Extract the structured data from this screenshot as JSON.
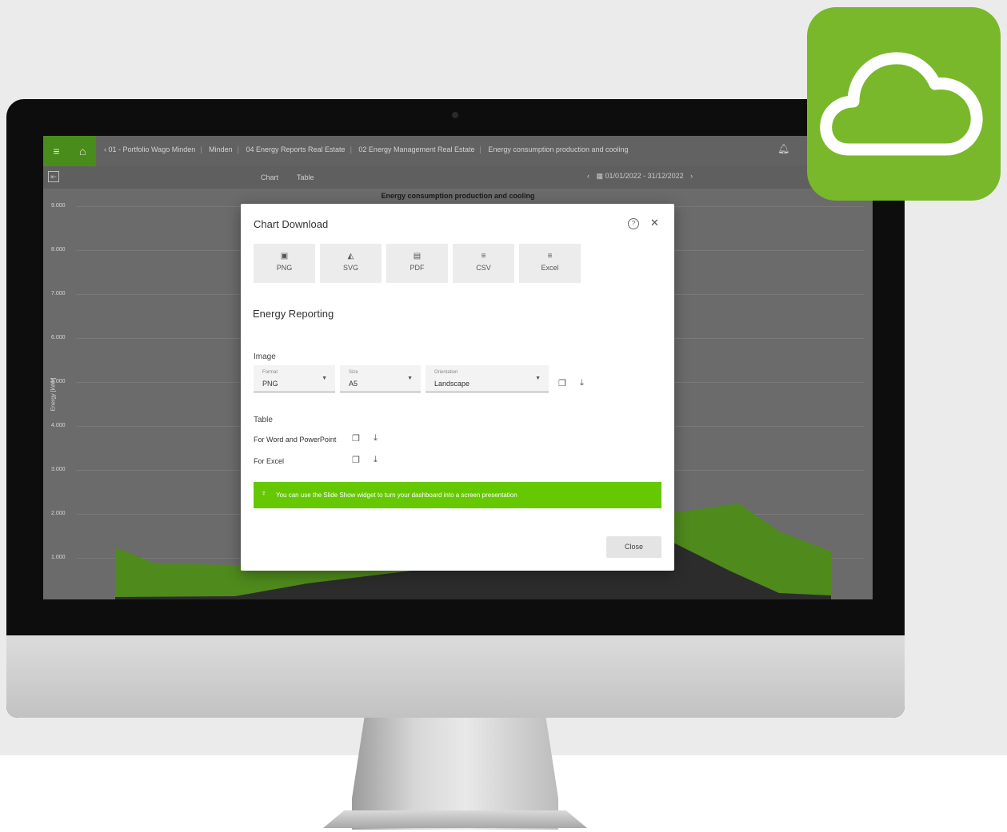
{
  "topbar": {
    "breadcrumb": [
      "01 - Portfolio Wago Minden",
      "Minden",
      "04 Energy Reports Real Estate",
      "02 Energy Management Real Estate",
      "Energy consumption production and cooling"
    ],
    "icons": [
      "menu-icon",
      "home-icon",
      "back-icon",
      "bell-icon"
    ]
  },
  "subbar": {
    "tabs": [
      "Chart",
      "Table"
    ],
    "date_range": "01/01/2022 - 31/12/2022"
  },
  "chart_data": {
    "type": "area",
    "title": "Energy consumption production and cooling",
    "ylabel": "Energy [kWh]",
    "y_ticks": [
      "9.000",
      "8.000",
      "7.000",
      "6.000",
      "5.000",
      "4.000",
      "3.000",
      "2.000",
      "1.000"
    ],
    "ylim": [
      0,
      9000
    ],
    "grid": true
  },
  "dialog": {
    "title": "Chart Download",
    "formats": [
      {
        "label": "PNG",
        "icon": "image-icon"
      },
      {
        "label": "SVG",
        "icon": "mountain-icon"
      },
      {
        "label": "PDF",
        "icon": "pdf-icon"
      },
      {
        "label": "CSV",
        "icon": "list-icon"
      },
      {
        "label": "Excel",
        "icon": "list-icon"
      }
    ],
    "section_title": "Energy Reporting",
    "image_label": "Image",
    "image": {
      "format_caption": "Format",
      "format_value": "PNG",
      "size_caption": "Size",
      "size_value": "A5",
      "orientation_caption": "Orientation",
      "orientation_value": "Landscape"
    },
    "table_label": "Table",
    "table_rows": [
      "For Word and PowerPoint",
      "For Excel"
    ],
    "tip": "You can use the Slide Show widget to turn your dashboard into a screen presentation",
    "close_label": "Close"
  },
  "colors": {
    "accent": "#66c800",
    "brand_green": "#78b82a",
    "dialog_bg": "#ffffff"
  }
}
